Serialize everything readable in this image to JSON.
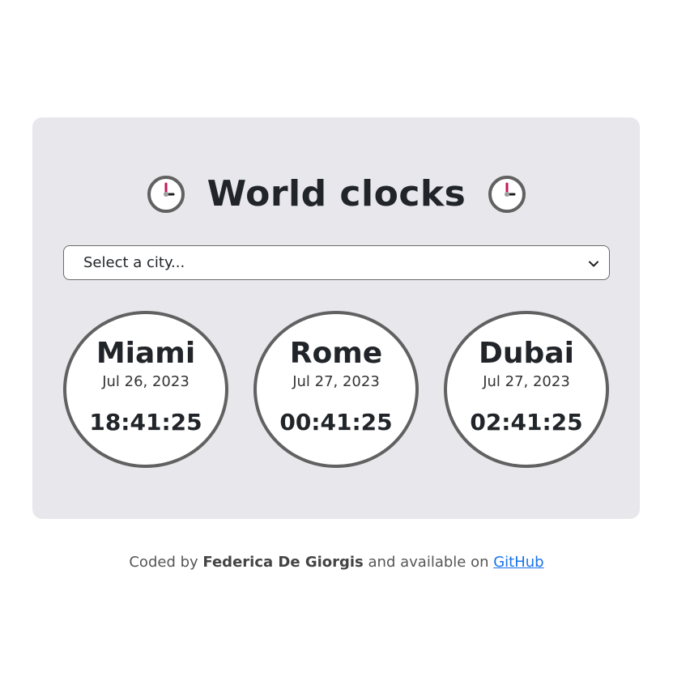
{
  "header": {
    "title": "World clocks"
  },
  "city_select": {
    "selected": "Select a city..."
  },
  "clocks": [
    {
      "city": "Miami",
      "date": "Jul 26, 2023",
      "time": "18:41:25"
    },
    {
      "city": "Rome",
      "date": "Jul 27, 2023",
      "time": "00:41:25"
    },
    {
      "city": "Dubai",
      "date": "Jul 27, 2023",
      "time": "02:41:25"
    }
  ],
  "footer": {
    "prefix": "Coded by",
    "author": "Federica De Giorgis",
    "middle": "and available on",
    "link_label": "GitHub"
  },
  "icons": {
    "title_left": "clock-icon",
    "title_right": "clock-icon",
    "select_arrow": "chevron-down-icon"
  },
  "colors": {
    "card_background": "#e8e8ec",
    "clock_border": "#616161",
    "clock_hand_accent": "#c2185b",
    "link": "#1a73e8"
  }
}
